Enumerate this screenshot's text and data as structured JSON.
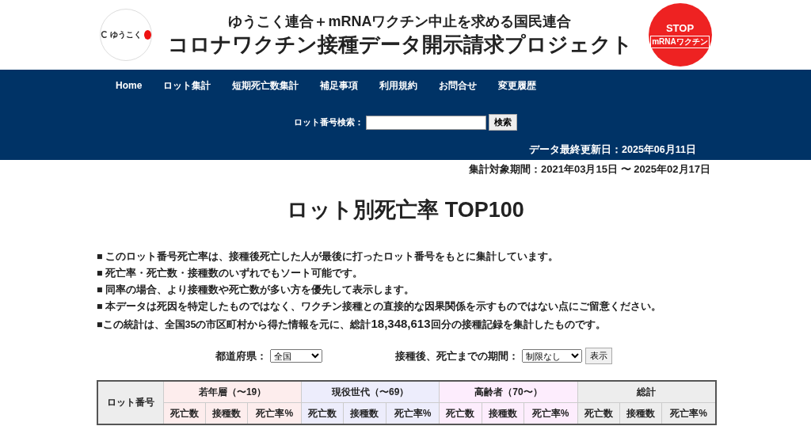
{
  "header": {
    "logo_left": {
      "text": "ゆうこく"
    },
    "subtitle": "ゆうこく連合＋mRNAワクチン中止を求める国民連合",
    "title": "コロナワクチン接種データ開示請求プロジェクト",
    "logo_right": {
      "stop": "STOP",
      "label": "mRNAワクチン"
    }
  },
  "nav": {
    "items": [
      {
        "label": "Home"
      },
      {
        "label": "ロット集計"
      },
      {
        "label": "短期死亡数集計"
      },
      {
        "label": "補足事項"
      },
      {
        "label": "利用規約"
      },
      {
        "label": "お問合せ"
      },
      {
        "label": "変更履歴"
      }
    ],
    "search": {
      "label": "ロット番号検索：",
      "button": "検索"
    },
    "updated": "データ最終更新日：2025年06月11日"
  },
  "period": "集計対象期間：2021年03月15日 〜 2025年02月17日",
  "page_title": "ロット別死亡率 TOP100",
  "notes": [
    "■ このロット番号死亡率は、接種後死亡した人が最後に打ったロット番号をもとに集計しています。",
    "■ 死亡率・死亡数・接種数のいずれでもソート可能です。",
    "■ 同率の場合、より接種数や死亡数が多い方を優先して表示します。",
    "■ 本データは死因を特定したものではなく、ワクチン接種との直接的な因果関係を示すものではない点にご留意ください。",
    "■この統計は、全国35の市区町村から得た情報を元に、総計**18,348,613**回分の接種記録を集計したものです。"
  ],
  "filters": {
    "prefecture": {
      "label": "都道府県：",
      "value": "全国"
    },
    "period": {
      "label": "接種後、死亡までの期間：",
      "value": "制限なし"
    },
    "button": "表示"
  },
  "table": {
    "lot_column": "ロット番号",
    "groups": [
      {
        "label": "若年層（〜19）",
        "color": "#fdeded",
        "columns": [
          "死亡数",
          "接種数",
          "死亡率%"
        ]
      },
      {
        "label": "現役世代（〜69）",
        "color": "#ededfc",
        "columns": [
          "死亡数",
          "接種数",
          "死亡率%"
        ]
      },
      {
        "label": "高齢者（70〜）",
        "color": "#fdedfd",
        "columns": [
          "死亡数",
          "接種数",
          "死亡率%"
        ]
      },
      {
        "label": "総計",
        "color": "#ededed",
        "columns": [
          "死亡数",
          "接種数",
          "死亡率%"
        ]
      }
    ]
  }
}
